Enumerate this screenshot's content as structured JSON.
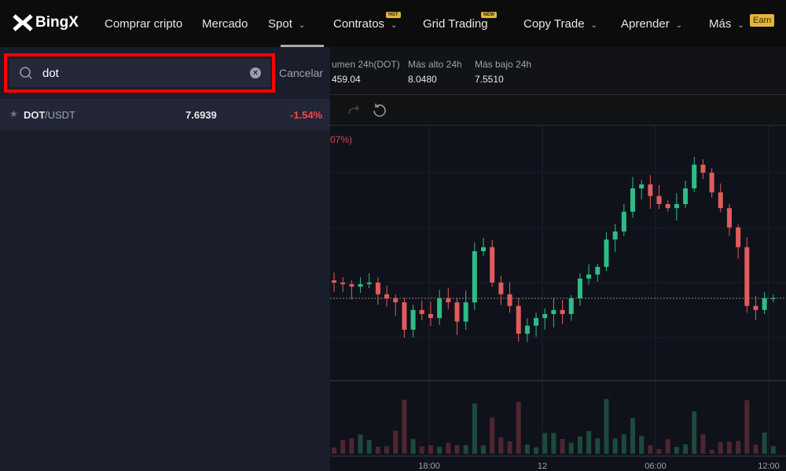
{
  "brand": "BingX",
  "nav": {
    "items": [
      {
        "label": "Comprar cripto",
        "chevron": false
      },
      {
        "label": "Mercado",
        "chevron": false
      },
      {
        "label": "Spot",
        "chevron": true
      },
      {
        "label": "Contratos",
        "chevron": true,
        "badge": "HOT"
      },
      {
        "label": "Grid Trading",
        "chevron": false,
        "badge": "NEW"
      },
      {
        "label": "Copy Trade",
        "chevron": true
      },
      {
        "label": "Aprender",
        "chevron": true
      },
      {
        "label": "Más",
        "chevron": true
      }
    ],
    "earn": "Earn"
  },
  "search": {
    "value": "dot",
    "cancel": "Cancelar"
  },
  "results": [
    {
      "base": "DOT",
      "quote": "/USDT",
      "price": "7.6939",
      "change": "-1.54%"
    }
  ],
  "stats": [
    {
      "label": "umen 24h(DOT)",
      "value": "459.04"
    },
    {
      "label": "Más alto 24h",
      "value": "8.0480"
    },
    {
      "label": "Más bajo 24h",
      "value": "7.5510"
    }
  ],
  "chart_data": {
    "type": "candlestick",
    "change_label": "07%)",
    "x_ticks": [
      "18:00",
      "12",
      "06:00",
      "12:00"
    ],
    "closes": [
      7.72,
      7.7165,
      7.711,
      7.7165,
      7.72,
      7.694,
      7.685,
      7.676,
      7.615,
      7.659,
      7.65,
      7.641,
      7.685,
      7.676,
      7.633,
      7.676,
      7.79,
      7.799,
      7.72,
      7.694,
      7.668,
      7.606,
      7.624,
      7.641,
      7.65,
      7.659,
      7.65,
      7.685,
      7.729,
      7.738,
      7.755,
      7.816,
      7.834,
      7.878,
      7.93,
      7.939,
      7.913,
      7.895,
      7.886,
      7.895,
      7.93,
      7.983,
      7.965,
      7.921,
      7.886,
      7.843,
      7.799,
      7.668,
      7.659,
      7.685,
      7.685
    ],
    "colors": {
      "up": "#2ebd85",
      "down": "#e15c5c"
    }
  }
}
